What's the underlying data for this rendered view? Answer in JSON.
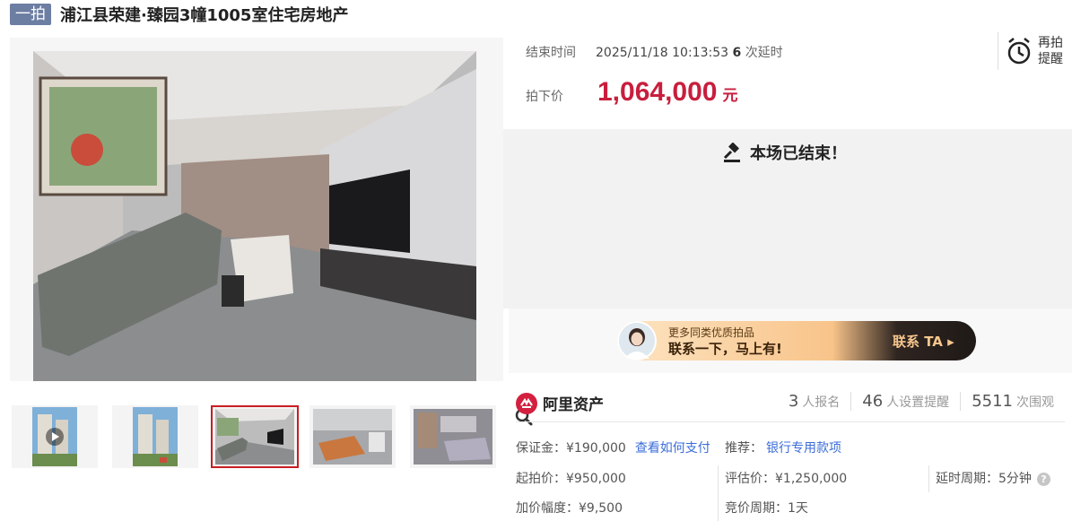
{
  "header": {
    "tag": "一拍",
    "title": "浦江县荣建·臻园3幢1005室住宅房地产"
  },
  "auction": {
    "end_time_label": "结束时间",
    "end_time": "2025/11/18 10:13:53",
    "extension_count": "6",
    "extension_label": "次延时",
    "remind_label": "再拍提醒",
    "price_label": "拍下价",
    "price": "1,064,000",
    "price_unit": "元",
    "ended_text": "本场已结束！"
  },
  "banner": {
    "subtitle": "更多同类优质拍品",
    "title": "联系一下，马上有!",
    "cta": "联系 TA"
  },
  "platform": {
    "name": "阿里资产"
  },
  "stats": [
    {
      "num": "3",
      "label": "人报名"
    },
    {
      "num": "46",
      "label": "人设置提醒"
    },
    {
      "num": "5511",
      "label": "次围观"
    }
  ],
  "details": {
    "deposit": "保证金：¥190,000",
    "deposit_link": "查看如何支付",
    "recommend": "推荐：",
    "recommend_link": "银行专用款项",
    "start_price": "起拍价：¥950,000",
    "appraisal": "评估价：¥1,250,000",
    "delay_period": "延时周期：5分钟",
    "increment": "加价幅度：¥9,500",
    "bid_period": "竞价周期：1天"
  },
  "colors": {
    "price": "#c81e3d",
    "tag_bg": "#6d7ea3",
    "link": "#3b6dd8",
    "active_thumb": "#c81e23"
  },
  "icons": [
    "alarm-clock-icon",
    "gavel-icon",
    "zoom-icon",
    "play-icon",
    "ali-logo-icon",
    "help-icon",
    "arrow-right-icon"
  ]
}
